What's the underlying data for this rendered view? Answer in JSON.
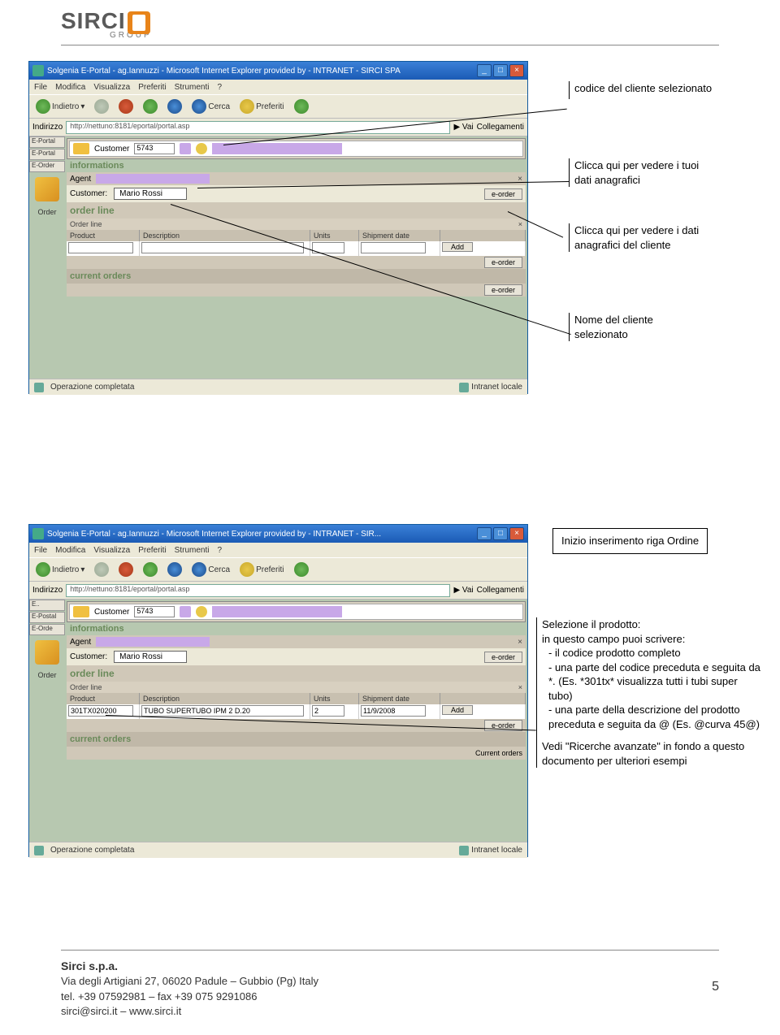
{
  "header": {
    "logo_main": "SIRCI",
    "logo_sub": "GROUP"
  },
  "browser1": {
    "title": "Solgenia E-Portal - ag.Iannuzzi - Microsoft Internet Explorer provided by - INTRANET - SIRCI SPA",
    "menu": [
      "File",
      "Modifica",
      "Visualizza",
      "Preferiti",
      "Strumenti",
      "?"
    ],
    "toolbar": {
      "back": "Indietro",
      "search": "Cerca",
      "fav": "Preferiti"
    },
    "addr_label": "Indirizzo",
    "url": "http://nettuno:8181/eportal/portal.asp",
    "go": "Vai",
    "links": "Collegamenti",
    "side_tabs": [
      "E-Portal",
      "E-Portal",
      "E-Order"
    ],
    "side_label": "Order",
    "customer_label": "Customer",
    "customer_value": "5743",
    "informations": "informations",
    "agent": "Agent",
    "customer2": "Customer:",
    "customer_name": "Mario Rossi",
    "eorder": "e-order",
    "orderline": "order line",
    "orderline2": "Order line",
    "cols": {
      "product": "Product",
      "desc": "Description",
      "units": "Units",
      "ship": "Shipment date",
      "add": "Add"
    },
    "current": "current orders",
    "status": "Operazione completata",
    "zone": "Intranet locale"
  },
  "browser2": {
    "title": "Solgenia E-Portal - ag.Iannuzzi - Microsoft Internet Explorer provided by - INTRANET - SIR...",
    "customer_value": "5743",
    "customer_name": "Mario Rossi",
    "prod_value": "301TX020200",
    "desc_value": "TUBO SUPERTUBO IPM 2 D.20",
    "units_value": "2",
    "ship_value": "11/9/2008",
    "current_row": "Current orders"
  },
  "callouts": {
    "c1": "codice del cliente selezionato",
    "c2": "Clicca qui per vedere i tuoi dati anagrafici",
    "c3": "Clicca qui per vedere i dati anagrafici del cliente",
    "c4": "Nome del cliente selezionato",
    "c5": "Inizio inserimento riga Ordine",
    "c6_title": "Selezione il prodotto:",
    "c6_intro": "in questo campo puoi scrivere:",
    "c6_b1": "il codice prodotto completo",
    "c6_b2": "una parte del codice preceduta e seguita da *. (Es. *301tx* visualizza tutti i tubi super tubo)",
    "c6_b3": "una parte della descrizione del prodotto preceduta e seguita da @ (Es. @curva 45@)",
    "c6_foot": "Vedi \"Ricerche avanzate\" in fondo a questo documento per ulteriori esempi"
  },
  "footer": {
    "company": "Sirci s.p.a.",
    "addr": "Via degli Artigiani 27, 06020 Padule – Gubbio (Pg) Italy",
    "tel": "tel. +39 07592981 – fax +39 075 9291086",
    "web": "sirci@sirci.it – www.sirci.it",
    "page": "5"
  }
}
